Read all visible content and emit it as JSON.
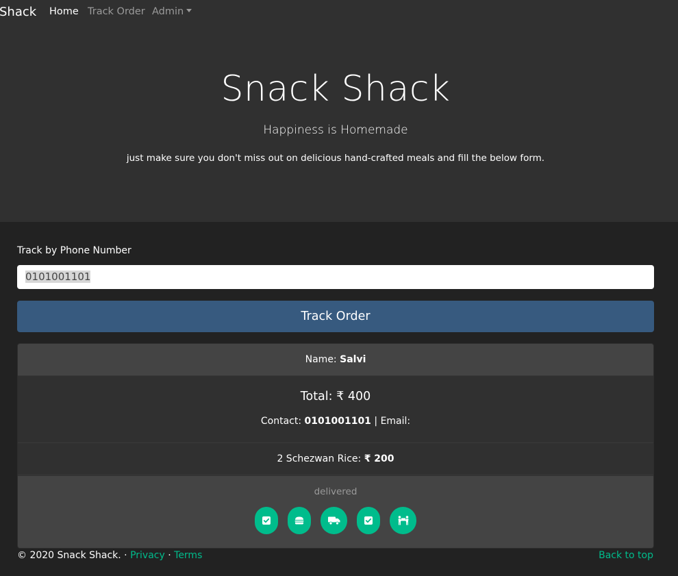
{
  "nav": {
    "brand": "Shack",
    "items": [
      {
        "label": "Home",
        "active": true
      },
      {
        "label": "Track Order",
        "active": false
      },
      {
        "label": "Admin",
        "active": false
      }
    ]
  },
  "hero": {
    "title": "Snack Shack",
    "subtitle": "Happiness is Homemade",
    "description": "just make sure you don't miss out on delicious hand-crafted meals and fill the below form."
  },
  "track": {
    "label": "Track by Phone Number",
    "phone_value": "0101001101",
    "button_label": "Track Order"
  },
  "order": {
    "name_label": "Name:",
    "name": "Salvi",
    "total_label": "Total:",
    "total": "₹ 400",
    "contact_label": "Contact:",
    "contact": "0101001101",
    "separator": "|",
    "email_label": "Email:",
    "items": [
      {
        "label": "2 Schezwan Rice:",
        "price": "₹ 200"
      }
    ],
    "status": "delivered",
    "status_icons": [
      "check-square-icon",
      "hamburger-icon",
      "shipping-truck-icon",
      "check-square-icon",
      "people-carry-icon"
    ]
  },
  "footer": {
    "copyright": "© 2020 Snack Shack.",
    "dot": "·",
    "privacy": "Privacy",
    "terms": "Terms",
    "back_to_top": "Back to top"
  },
  "colors": {
    "background": "#222222",
    "navbar": "#303030",
    "primary_button": "#375a7f",
    "accent": "#00bc8c"
  }
}
